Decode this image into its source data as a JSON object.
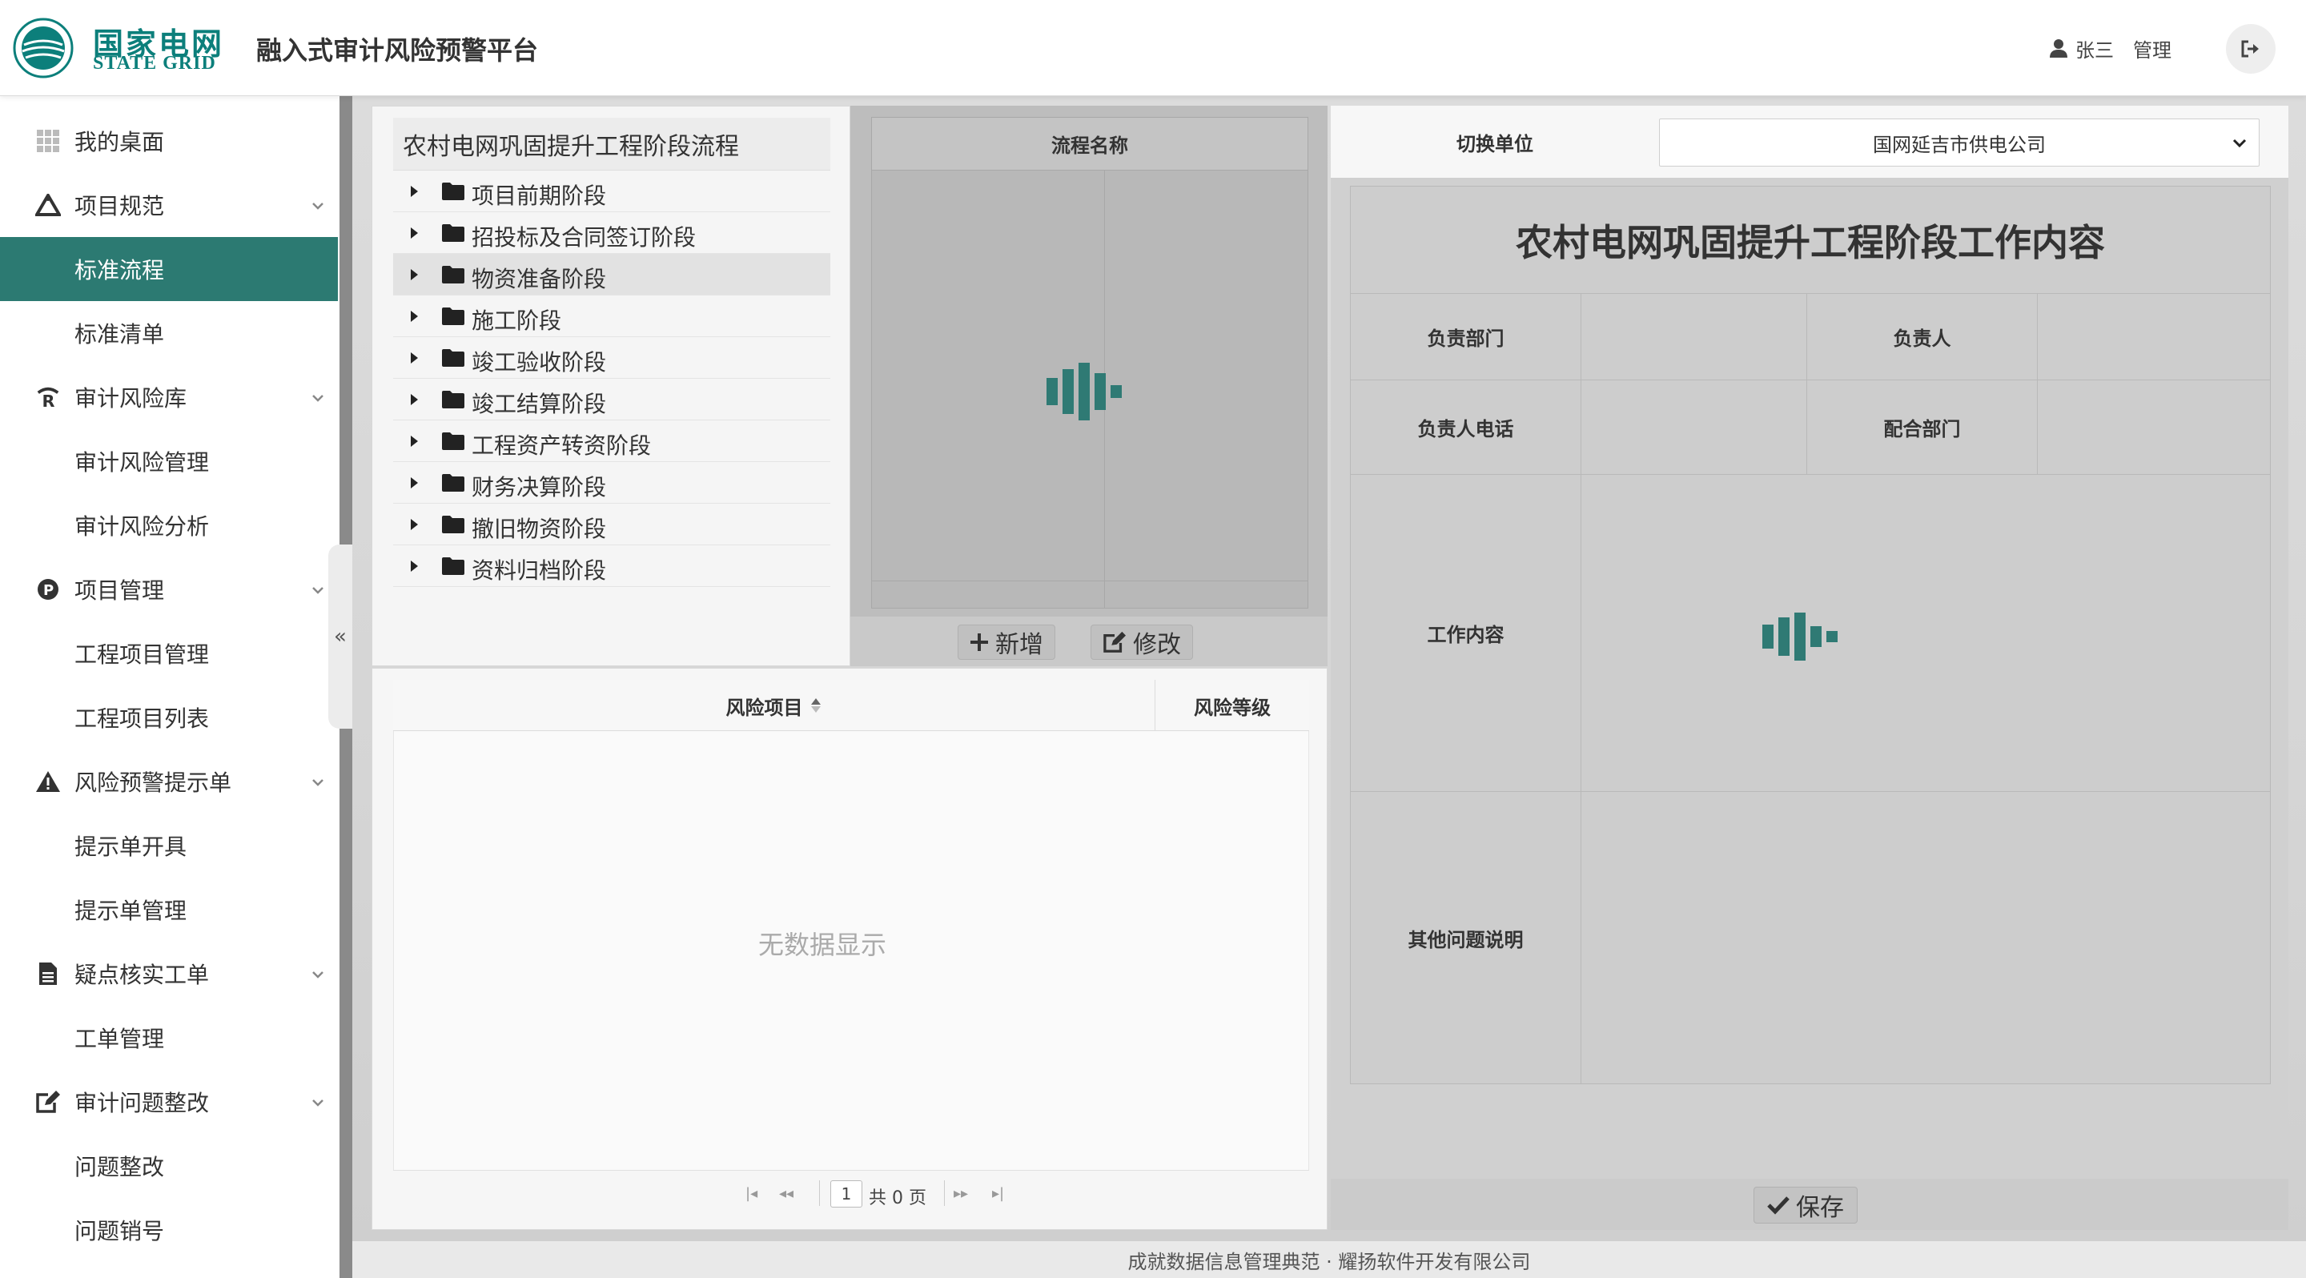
{
  "header": {
    "logo_cn": "国家电网",
    "logo_en": "STATE GRID",
    "platform_title": "融入式审计风险预警平台",
    "user_name": "张三",
    "user_role": "管理"
  },
  "sidebar": {
    "items": [
      {
        "label": "我的桌面",
        "icon": "dashboard-grid-icon",
        "level": 1
      },
      {
        "label": "项目规范",
        "icon": "triangle-compass-icon",
        "level": 1,
        "expandable": true
      },
      {
        "label": "标准流程",
        "level": 2,
        "active": true
      },
      {
        "label": "标准清单",
        "level": 2
      },
      {
        "label": "审计风险库",
        "icon": "risk-r-icon",
        "level": 1,
        "expandable": true
      },
      {
        "label": "审计风险管理",
        "level": 2
      },
      {
        "label": "审计风险分析",
        "level": 2
      },
      {
        "label": "项目管理",
        "icon": "p-circle-icon",
        "level": 1,
        "expandable": true
      },
      {
        "label": "工程项目管理",
        "level": 2
      },
      {
        "label": "工程项目列表",
        "level": 2
      },
      {
        "label": "风险预警提示单",
        "icon": "warning-triangle-icon",
        "level": 1,
        "expandable": true
      },
      {
        "label": "提示单开具",
        "level": 2
      },
      {
        "label": "提示单管理",
        "level": 2
      },
      {
        "label": "疑点核实工单",
        "icon": "document-icon",
        "level": 1,
        "expandable": true
      },
      {
        "label": "工单管理",
        "level": 2
      },
      {
        "label": "审计问题整改",
        "icon": "edit-icon",
        "level": 1,
        "expandable": true
      },
      {
        "label": "问题整改",
        "level": 2
      },
      {
        "label": "问题销号",
        "level": 2
      }
    ],
    "collapse_glyph": "«"
  },
  "tree": {
    "title": "农村电网巩固提升工程阶段流程",
    "nodes": [
      "项目前期阶段",
      "招投标及合同签订阶段",
      "物资准备阶段",
      "施工阶段",
      "竣工验收阶段",
      "竣工结算阶段",
      "工程资产转资阶段",
      "财务决算阶段",
      "撤旧物资阶段",
      "资料归档阶段"
    ],
    "selected_index": 2
  },
  "process": {
    "header": "流程名称",
    "add_label": "新增",
    "edit_label": "修改"
  },
  "risk_table": {
    "col_item": "风险项目",
    "col_level": "风险等级",
    "empty_text": "无数据显示",
    "current_page": "1",
    "total_pages": "共 0 页"
  },
  "detail": {
    "switch_label": "切换单位",
    "unit_selected": "国网延吉市供电公司",
    "title": "农村电网巩固提升工程阶段工作内容",
    "dept_label": "负责部门",
    "owner_label": "负责人",
    "phone_label": "负责人电话",
    "coop_label": "配合部门",
    "work_label": "工作内容",
    "other_label": "其他问题说明",
    "save_label": "保存"
  },
  "footer": {
    "text": "成就数据信息管理典范 · 耀扬软件开发有限公司"
  },
  "colors": {
    "brand": "#0c7f7b",
    "active_menu": "#2c7a72",
    "loader": "#2f7a74"
  }
}
